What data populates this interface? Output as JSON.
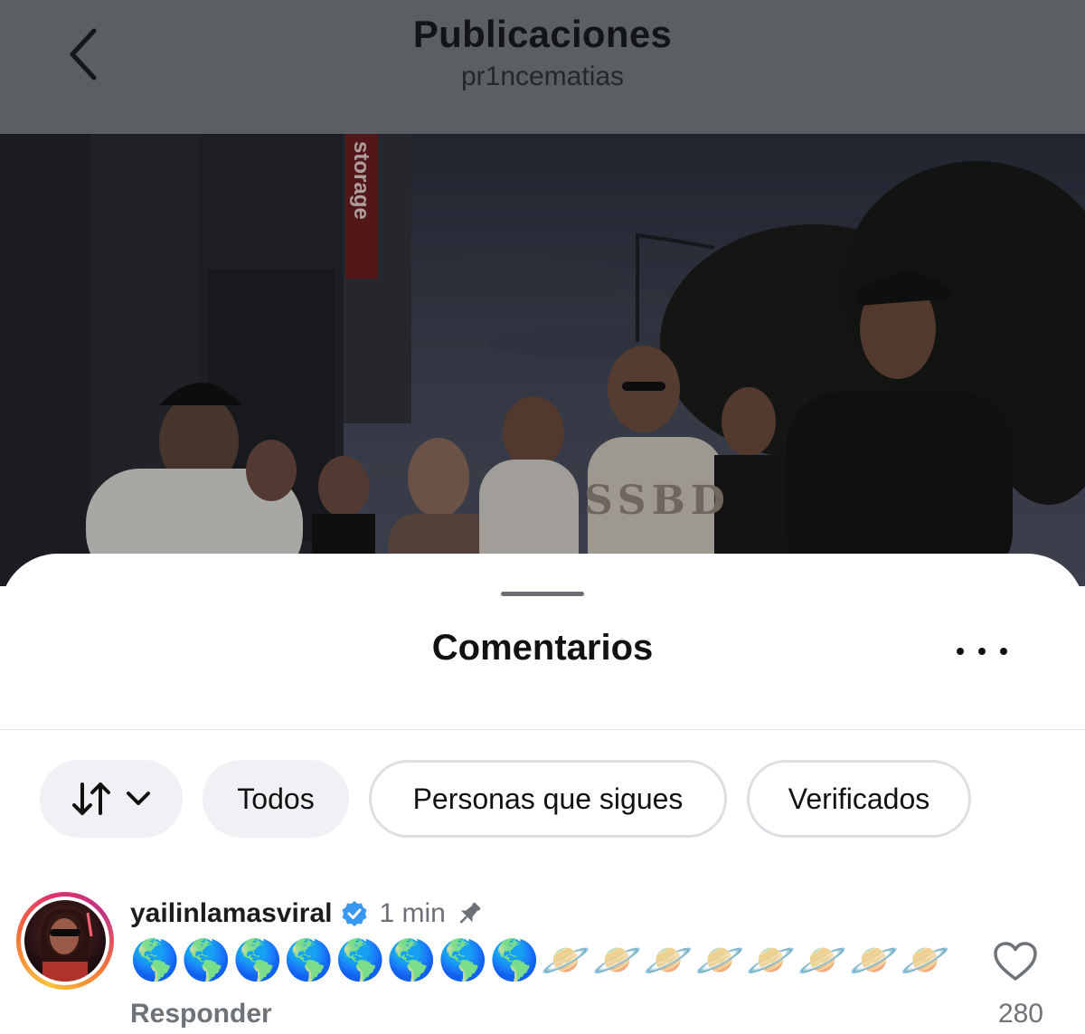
{
  "header": {
    "title": "Publicaciones",
    "subtitle": "pr1ncematias"
  },
  "photo": {
    "sign_text": "storage",
    "shirt_text": "SSBD"
  },
  "comments_sheet": {
    "title": "Comentarios",
    "filters": [
      {
        "label": "Todos",
        "selected": true
      },
      {
        "label": "Personas que sigues",
        "selected": false
      },
      {
        "label": "Verificados",
        "selected": false
      }
    ],
    "comment": {
      "username": "yailinlamasviral",
      "verified": true,
      "time": "1 min",
      "pinned": true,
      "text": "🌎🌎🌎🌎🌎🌎🌎🌎🪐🪐🪐🪐🪐🪐🪐🪐",
      "reply_label": "Responder",
      "likes": "280"
    }
  },
  "colors": {
    "header_bg": "#5b5f63",
    "chip_fill": "#eff1f4",
    "chip_border": "#dcdfe3",
    "verified_blue": "#3897f0",
    "muted_text": "#6e7378"
  },
  "icons": [
    "chevron-left-icon",
    "sort-arrows-icon",
    "chevron-down-icon",
    "more-icon",
    "verified-badge-icon",
    "pin-icon",
    "heart-icon"
  ]
}
